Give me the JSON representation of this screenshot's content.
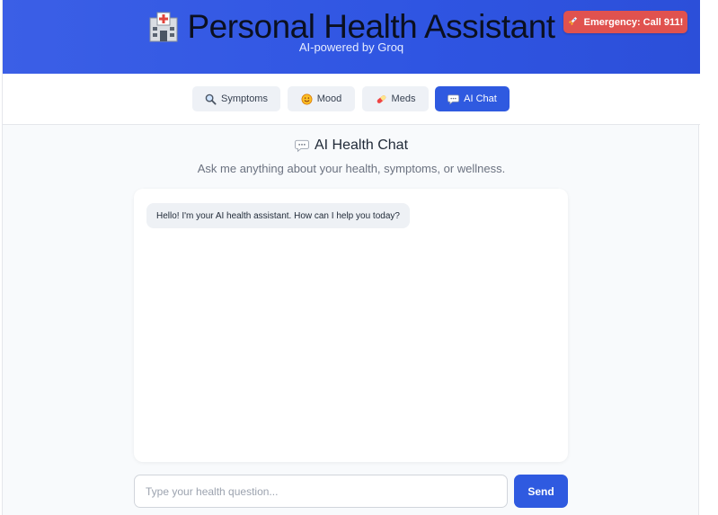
{
  "header": {
    "title": "Personal Health Assistant",
    "subtitle": "AI-powered by Groq",
    "title_icon": "hospital-icon",
    "emergency_label": "Emergency: Call 911!",
    "emergency_icon": "rocket-icon"
  },
  "tabs": [
    {
      "label": "Symptoms",
      "icon": "magnifier-icon",
      "active": false
    },
    {
      "label": "Mood",
      "icon": "smiley-icon",
      "active": false
    },
    {
      "label": "Meds",
      "icon": "pill-icon",
      "active": false
    },
    {
      "label": "AI Chat",
      "icon": "speech-bubble-icon",
      "active": true
    }
  ],
  "chat": {
    "title": "AI Health Chat",
    "title_icon": "speech-bubble-icon",
    "subtitle": "Ask me anything about your health, symptoms, or wellness.",
    "messages": [
      {
        "sender": "assistant",
        "text": "Hello! I'm your AI health assistant. How can I help you today?"
      }
    ],
    "input_placeholder": "Type your health question...",
    "input_value": "",
    "send_label": "Send"
  },
  "colors": {
    "header_bg": "#2f55e2",
    "accent": "#2f5ae0",
    "emergency": "#e0524f",
    "background": "#f8fafc"
  }
}
